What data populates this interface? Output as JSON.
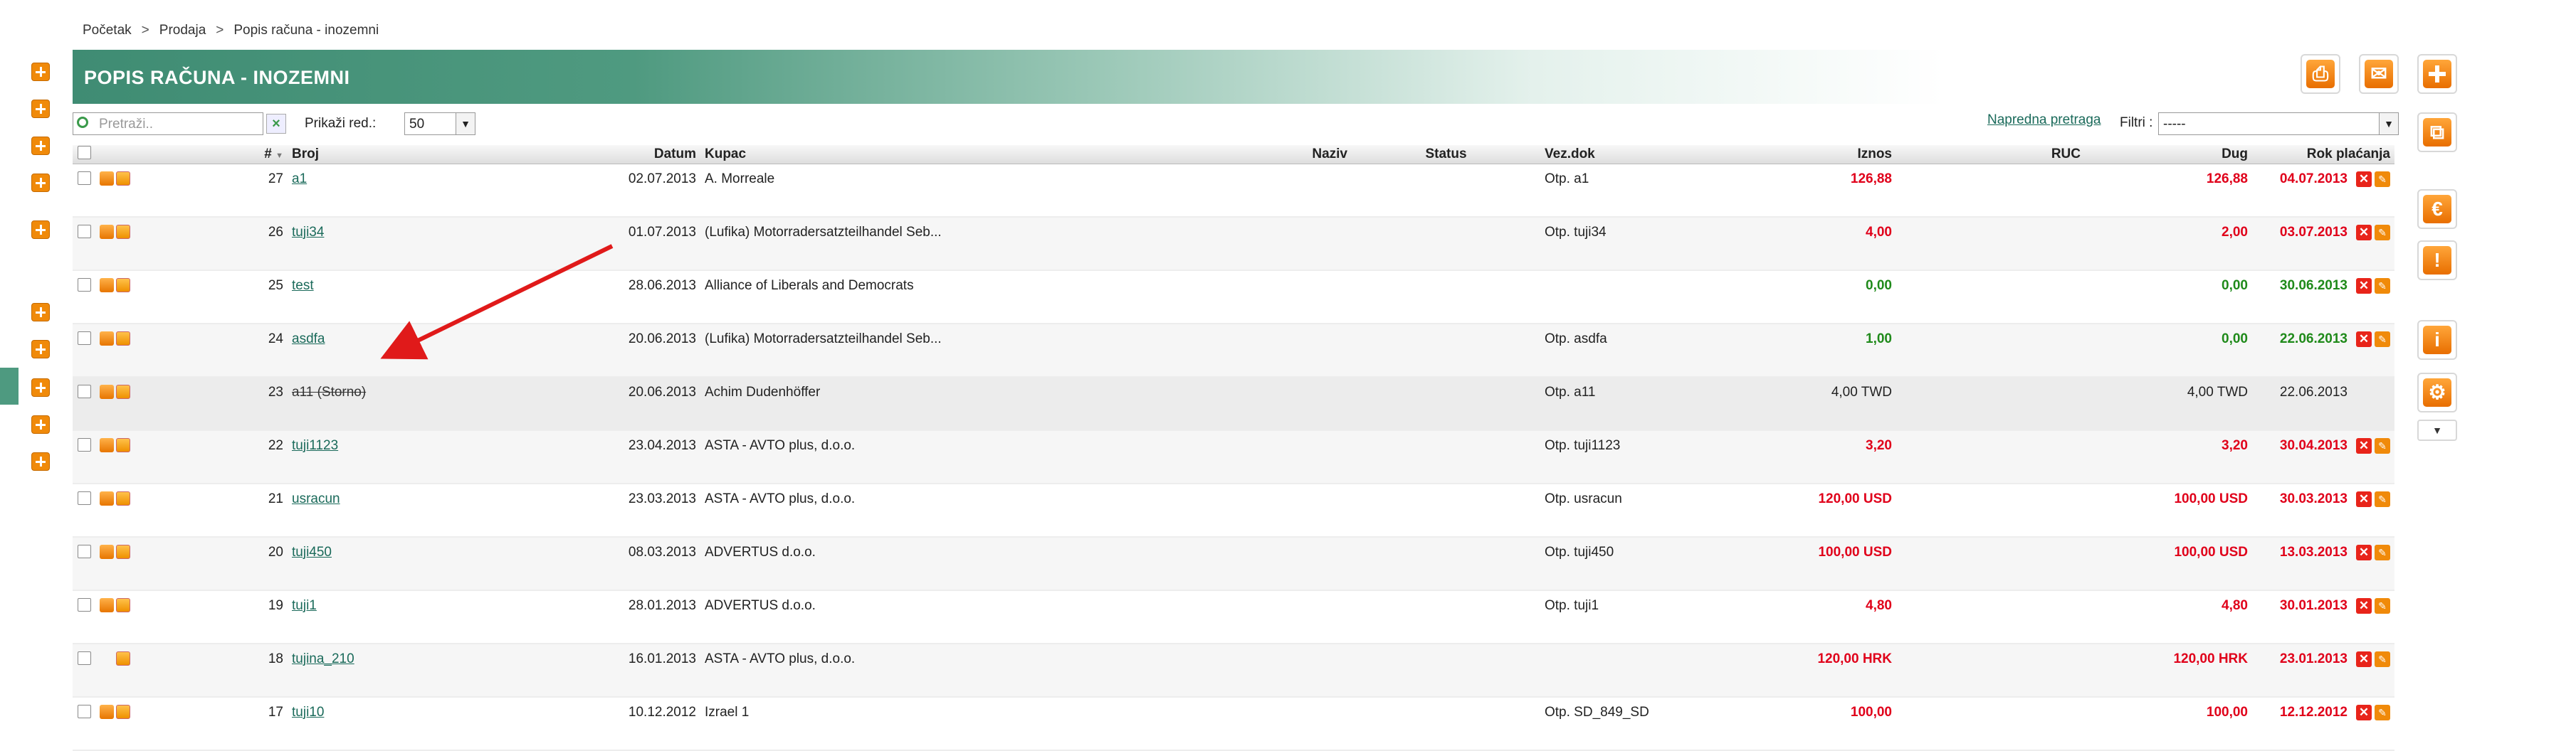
{
  "breadcrumb": [
    "Početak",
    "Prodaja",
    "Popis računa - inozemni"
  ],
  "page_title": "POPIS RAČUNA - INOZEMNI",
  "search": {
    "placeholder": "Pretraži.."
  },
  "rows_label": "Prikaži red.:",
  "rows_value": "50",
  "advanced_search": "Napredna pretraga",
  "filters_label": "Filtri :",
  "filters_value": "-----",
  "columns": [
    "#",
    "Broj",
    "Datum",
    "Kupac",
    "Naziv",
    "Status",
    "Vez.dok",
    "Iznos",
    "RUC",
    "Dug",
    "Rok plaćanja"
  ],
  "rows": [
    {
      "num": "27",
      "broj": "a1",
      "datum": "02.07.2013",
      "kupac": "A. Morreale",
      "vez": "Otp. a1",
      "iznos": "126,88",
      "dug": "126,88",
      "rok": "04.07.2013",
      "state": "red",
      "actions": true,
      "printer": true
    },
    {
      "num": "26",
      "broj": "tuji34",
      "datum": "01.07.2013",
      "kupac": "(Lufika) Motorradersatzteilhandel Seb...",
      "vez": "Otp. tuji34",
      "iznos": "4,00",
      "dug": "2,00",
      "rok": "03.07.2013",
      "state": "red",
      "actions": true,
      "printer": true
    },
    {
      "num": "25",
      "broj": "test",
      "datum": "28.06.2013",
      "kupac": "Alliance of Liberals and Democrats",
      "vez": "",
      "iznos": "0,00",
      "dug": "0,00",
      "rok": "30.06.2013",
      "state": "green",
      "actions": true,
      "printer": true
    },
    {
      "num": "24",
      "broj": "asdfa",
      "datum": "20.06.2013",
      "kupac": "(Lufika) Motorradersatzteilhandel Seb...",
      "vez": "Otp. asdfa",
      "iznos": "1,00",
      "dug": "0,00",
      "rok": "22.06.2013",
      "state": "green",
      "actions": true,
      "printer": true
    },
    {
      "num": "23",
      "broj": "a11 (Storno)",
      "datum": "20.06.2013",
      "kupac": "Achim Dudenhöffer",
      "vez": "Otp. a11",
      "iznos": "4,00 TWD",
      "dug": "4,00 TWD",
      "rok": "22.06.2013",
      "state": "storno",
      "actions": false,
      "printer": true
    },
    {
      "num": "22",
      "broj": "tuji1123",
      "datum": "23.04.2013",
      "kupac": "ASTA - AVTO plus, d.o.o.",
      "vez": "Otp. tuji1123",
      "iznos": "3,20",
      "dug": "3,20",
      "rok": "30.04.2013",
      "state": "red",
      "actions": true,
      "printer": true
    },
    {
      "num": "21",
      "broj": "usracun",
      "datum": "23.03.2013",
      "kupac": "ASTA - AVTO plus, d.o.o.",
      "vez": "Otp. usracun",
      "iznos": "120,00 USD",
      "dug": "100,00 USD",
      "rok": "30.03.2013",
      "state": "red",
      "actions": true,
      "printer": true
    },
    {
      "num": "20",
      "broj": "tuji450",
      "datum": "08.03.2013",
      "kupac": "ADVERTUS d.o.o.",
      "vez": "Otp. tuji450",
      "iznos": "100,00 USD",
      "dug": "100,00 USD",
      "rok": "13.03.2013",
      "state": "red",
      "actions": true,
      "printer": true
    },
    {
      "num": "19",
      "broj": "tuji1",
      "datum": "28.01.2013",
      "kupac": "ADVERTUS d.o.o.",
      "vez": "Otp. tuji1",
      "iznos": "4,80",
      "dug": "4,80",
      "rok": "30.01.2013",
      "state": "red",
      "actions": true,
      "printer": true
    },
    {
      "num": "18",
      "broj": "tujina_210",
      "datum": "16.01.2013",
      "kupac": "ASTA - AVTO plus, d.o.o.",
      "vez": "",
      "iznos": "120,00 HRK",
      "dug": "120,00 HRK",
      "rok": "23.01.2013",
      "state": "red",
      "actions": true,
      "printer": false
    },
    {
      "num": "17",
      "broj": "tuji10",
      "datum": "10.12.2012",
      "kupac": "Izrael 1",
      "vez": "Otp. SD_849_SD",
      "iznos": "100,00",
      "dug": "100,00",
      "rok": "12.12.2012",
      "state": "red",
      "actions": true,
      "printer": true
    }
  ],
  "colors": {
    "accent": "#4f9a80",
    "orange": "#f08a0a",
    "red": "#e0001a",
    "green": "#1f8a1a"
  },
  "toolbar_icons": [
    "printer-icon",
    "mail-icon",
    "plus-icon",
    "copy-icon",
    "euro-icon",
    "alert-icon",
    "info-icon",
    "gear-icon",
    "chevron-down-icon"
  ]
}
